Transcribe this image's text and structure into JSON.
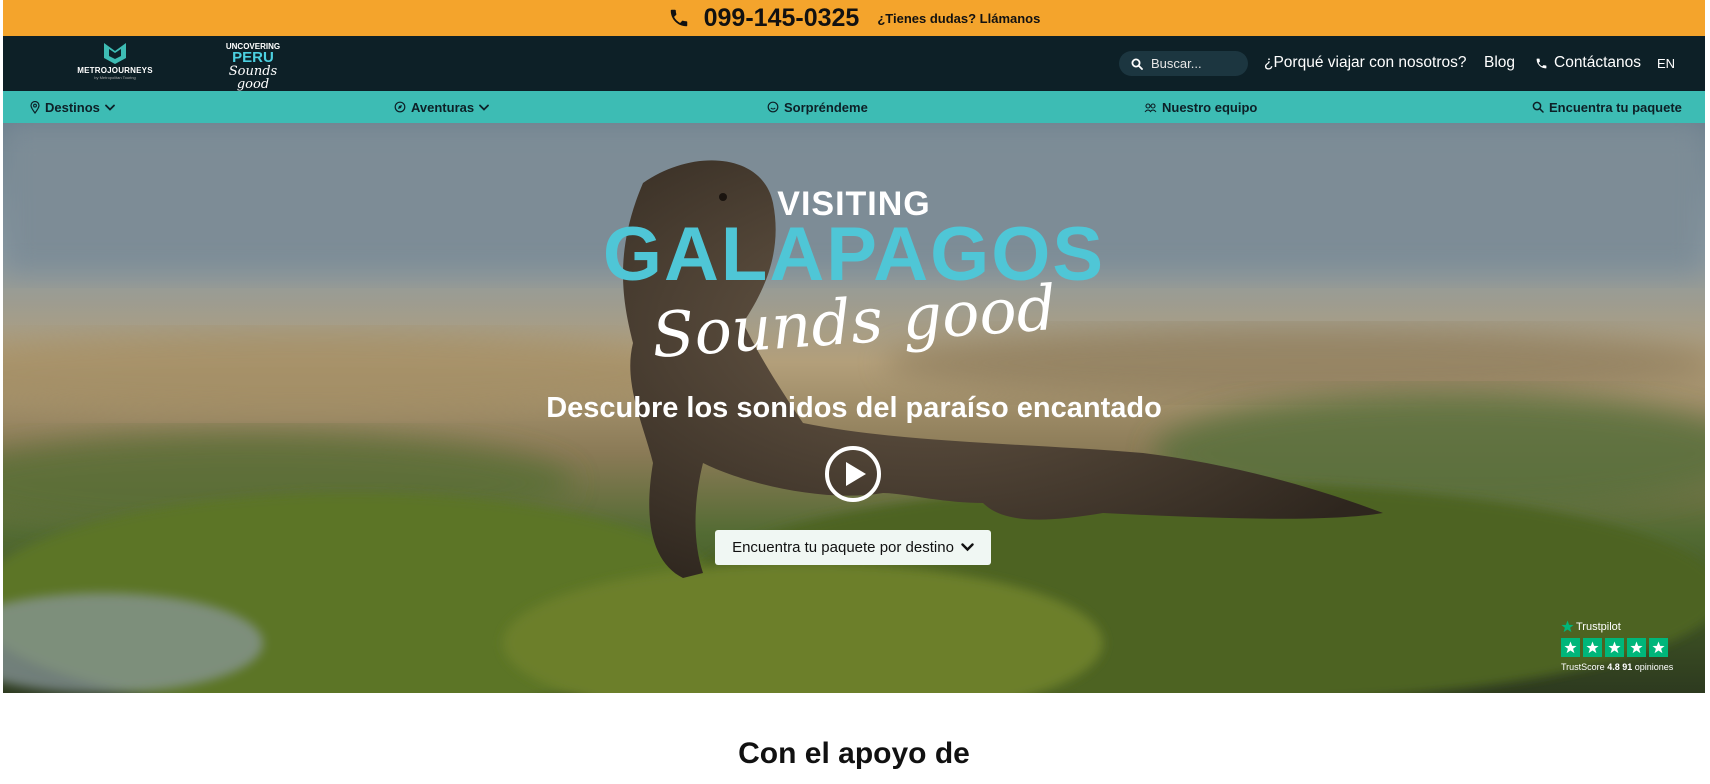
{
  "topbar": {
    "phone": "099-145-0325",
    "question": "¿Tienes dudas? Llámanos"
  },
  "header": {
    "logo_metro_name": "METROJOURNEYS",
    "logo_metro_by": "by Metropolitan Touring",
    "logo_peru_line1": "UNCOVERING",
    "logo_peru_line2": "PERU",
    "logo_peru_line3": "Sounds good",
    "search_placeholder": "Buscar...",
    "why_label": "¿Porqué viajar con nosotros?",
    "blog_label": "Blog",
    "contact_label": "Contáctanos",
    "lang_label": "EN"
  },
  "subnav": {
    "destinos": "Destinos",
    "aventuras": "Aventuras",
    "sorprendeme": "Sorpréndeme",
    "equipo": "Nuestro equipo",
    "paquete": "Encuentra tu paquete"
  },
  "hero": {
    "visiting": "VISITING",
    "galapagos": "GALAPAGOS",
    "sounds_good": "Sounds good",
    "tagline": "Descubre los sonidos del paraíso encantado",
    "destination_button": "Encuentra tu paquete por destino"
  },
  "trustpilot": {
    "brand": "Trustpilot",
    "score_label": "TrustScore",
    "score": "4.8",
    "reviews": "91",
    "reviews_label": "opiniones",
    "rating_stars": 5
  },
  "section": {
    "support_title": "Con el apoyo de"
  },
  "colors": {
    "topbar": "#f4a42c",
    "nav": "#0d2027",
    "subnav": "#3dbcb4",
    "accent": "#4fc6d6",
    "trust_green": "#00b67a"
  }
}
